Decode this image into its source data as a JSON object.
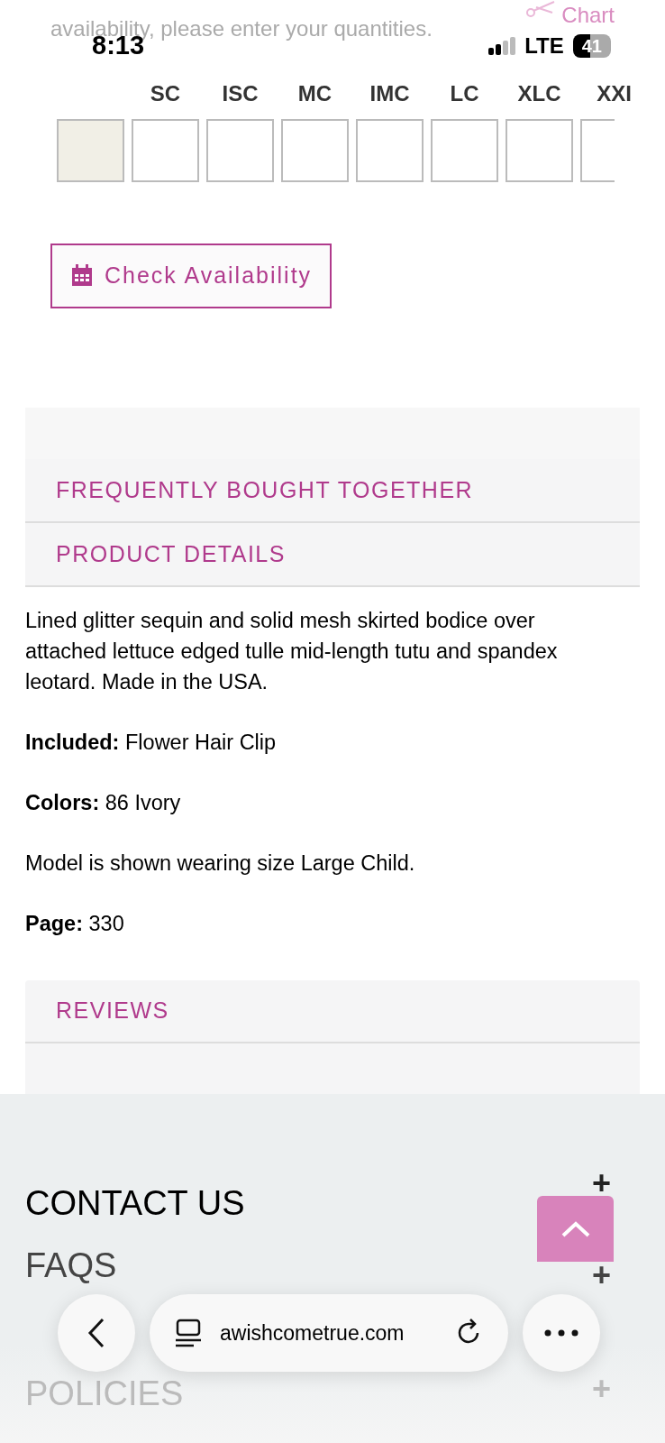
{
  "status_bar": {
    "time": "8:13",
    "network": "LTE",
    "battery": "41"
  },
  "intro": {
    "text": "availability, please enter your quantities.",
    "size_chart_label": "Chart"
  },
  "sizes": [
    {
      "disabled": true
    },
    {
      "label": "SC",
      "disabled": false
    },
    {
      "label": "ISC",
      "disabled": false
    },
    {
      "label": "MC",
      "disabled": false
    },
    {
      "label": "IMC",
      "disabled": false
    },
    {
      "label": "LC",
      "disabled": false
    },
    {
      "label": "XLC",
      "disabled": false
    },
    {
      "label": "XXI",
      "disabled": false
    }
  ],
  "check_button": "Check Availability",
  "sections": [
    {
      "title": "FREQUENTLY BOUGHT TOGETHER"
    },
    {
      "title": "PRODUCT DETAILS"
    }
  ],
  "details": [
    "Lined glitter sequin and solid mesh skirted bodice over attached lettuce edged tulle mid-length tutu and spandex leotard. Made in the USA.",
    "**Included:** Flower Hair Clip",
    "**Colors:** 86 Ivory",
    "Model is shown wearing size Large Child.",
    "**Page:** 330"
  ],
  "reviews_title": "REVIEWS",
  "footer": [
    {
      "title": "CONTACT US",
      "toggle": "+"
    },
    {
      "title": "FAQS",
      "toggle": "+"
    },
    {
      "title": "POLICIES",
      "toggle": "+"
    }
  ],
  "browser": {
    "url": "awishcometrue.com"
  }
}
